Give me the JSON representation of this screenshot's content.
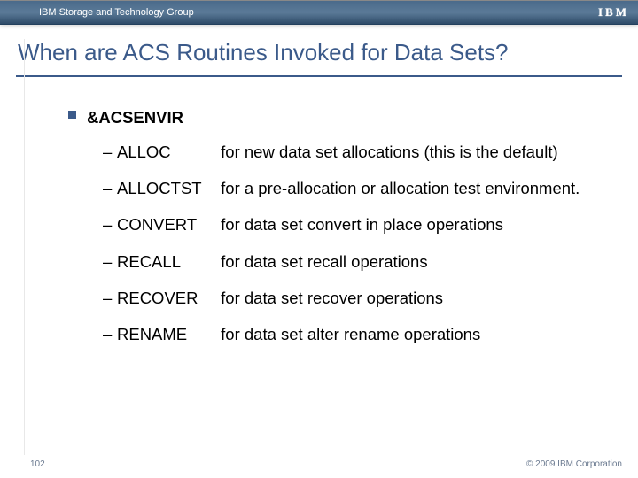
{
  "header": {
    "group": "IBM Storage and Technology Group",
    "brand": "IBM"
  },
  "title": "When are ACS Routines Invoked for Data Sets?",
  "section": "&ACSENVIR",
  "items": [
    {
      "keyword": "ALLOC",
      "desc": "for new data set allocations (this is the default)"
    },
    {
      "keyword": "ALLOCTST",
      "desc": "for a pre-allocation or allocation test environment."
    },
    {
      "keyword": "CONVERT",
      "desc": "for data set convert in place operations"
    },
    {
      "keyword": "RECALL",
      "desc": "for data set recall operations"
    },
    {
      "keyword": "RECOVER",
      "desc": "for data set recover operations"
    },
    {
      "keyword": "RENAME",
      "desc": "for data set alter rename operations"
    }
  ],
  "footer": {
    "page": "102",
    "copyright": "© 2009 IBM Corporation"
  }
}
